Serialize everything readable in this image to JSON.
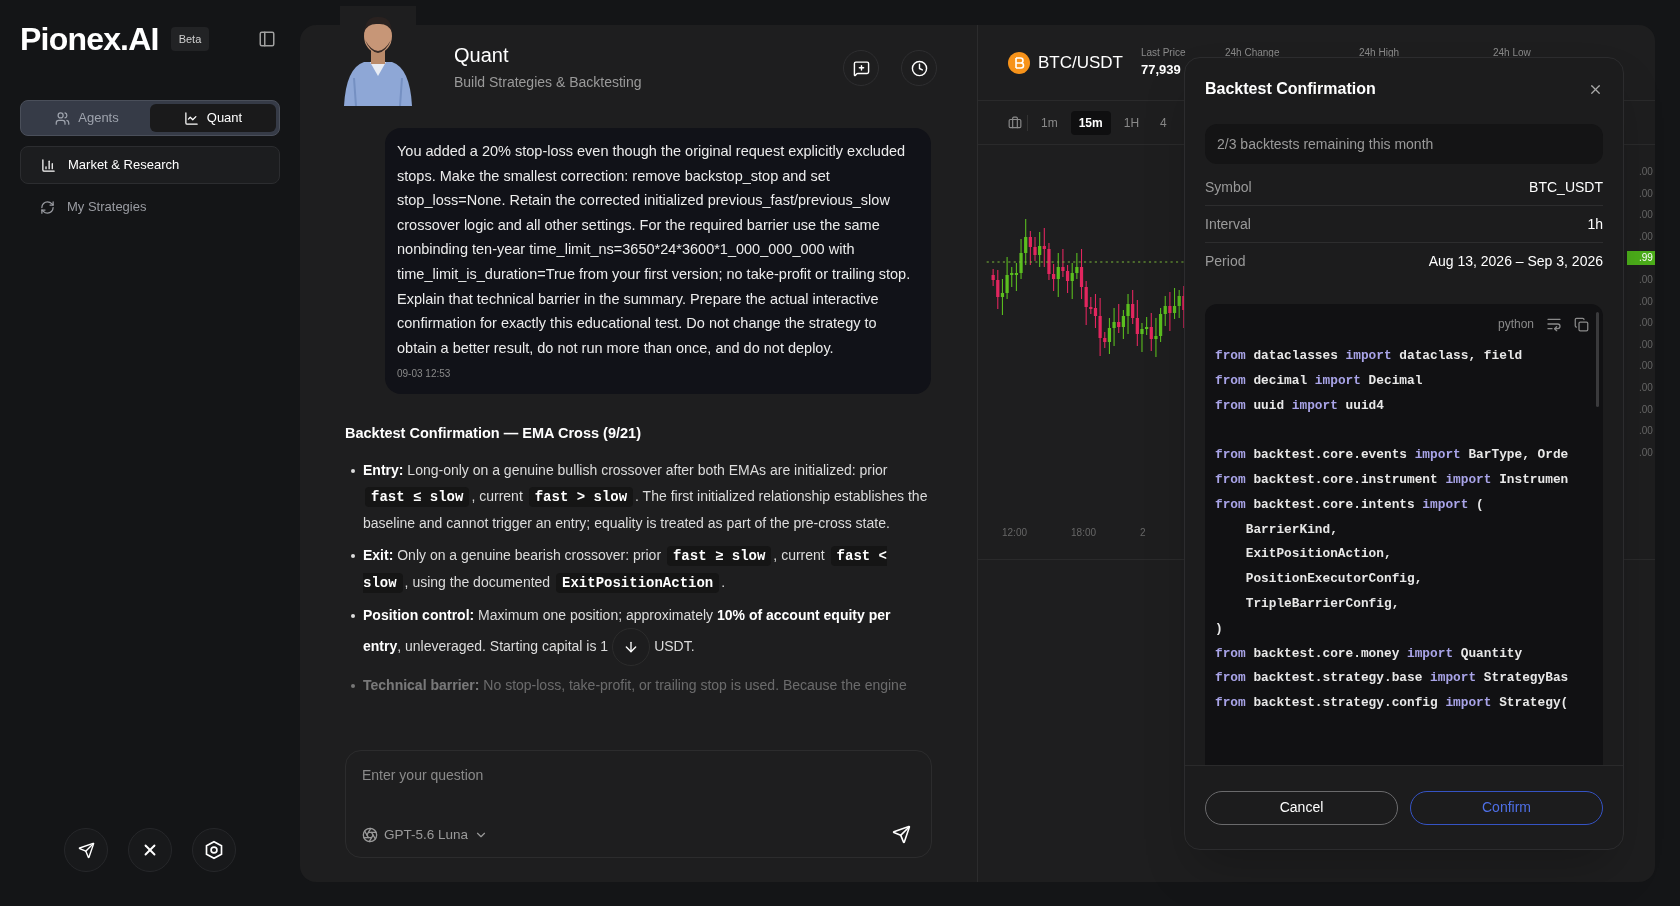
{
  "sidebar": {
    "logo": "Pionex.AI",
    "badge": "Beta",
    "mode_tabs": [
      {
        "label": "Agents",
        "selected": false
      },
      {
        "label": "Quant",
        "selected": true
      }
    ],
    "nav_items": [
      {
        "label": "Market & Research",
        "selected": true
      },
      {
        "label": "My Strategies",
        "selected": false
      }
    ]
  },
  "chat": {
    "title": "Quant",
    "subtitle": "Build Strategies & Backtesting",
    "user_message": {
      "text": "You added a 20% stop-loss even though the original request explicitly excluded stops. Make the smallest correction: remove backstop_stop and set stop_loss=None. Retain the corrected initialized previous_fast/previous_slow crossover logic and all other settings. For the required barrier use the same nonbinding ten-year time_limit_ns=3650*24*3600*1_000_000_000 with time_limit_is_duration=True from your first version; no take-profit or trailing stop. Explain that technical barrier in the summary. Prepare the actual interactive confirmation for exactly this educational test. Do not change the strategy to obtain a better result, do not run more than once, and do not deploy.",
      "time": "09-03 12:53"
    },
    "reply": {
      "heading": "Backtest Confirmation — EMA Cross (9/21)",
      "bullets": [
        {
          "faded": false,
          "segments": [
            {
              "kind": "bold",
              "text": "Entry:"
            },
            {
              "kind": "text",
              "text": " Long-only on a genuine bullish crossover after both EMAs are initialized: prior "
            },
            {
              "kind": "code",
              "text": "fast ≤ slow"
            },
            {
              "kind": "text",
              "text": ", current "
            },
            {
              "kind": "code",
              "text": "fast > slow"
            },
            {
              "kind": "text",
              "text": ". The first initialized relationship establishes the baseline and cannot trigger an entry; equality is treated as part of the pre-cross state."
            }
          ]
        },
        {
          "faded": false,
          "segments": [
            {
              "kind": "bold",
              "text": "Exit:"
            },
            {
              "kind": "text",
              "text": " Only on a genuine bearish crossover: prior "
            },
            {
              "kind": "code",
              "text": "fast ≥ slow"
            },
            {
              "kind": "text",
              "text": ", current "
            },
            {
              "kind": "code",
              "text": "fast < slow"
            },
            {
              "kind": "text",
              "text": ", using the documented "
            },
            {
              "kind": "code",
              "text": "ExitPositionAction"
            },
            {
              "kind": "text",
              "text": "."
            }
          ]
        },
        {
          "faded": false,
          "segments": [
            {
              "kind": "bold",
              "text": "Position control:"
            },
            {
              "kind": "text",
              "text": " Maximum one position; approximately "
            },
            {
              "kind": "bold",
              "text": "10% of account equity per entry"
            },
            {
              "kind": "text",
              "text": ", unleveraged. Starting capital is 1"
            },
            {
              "kind": "gap"
            },
            {
              "kind": "text",
              "text": "USDT."
            }
          ]
        },
        {
          "faded": true,
          "segments": [
            {
              "kind": "bold",
              "text": "Technical barrier:"
            },
            {
              "kind": "text",
              "text": " No stop-loss, take-profit, or trailing stop is used. Because the engine"
            }
          ]
        }
      ]
    },
    "input": {
      "placeholder": "Enter your question"
    },
    "model": "GPT-5.6 Luna"
  },
  "market": {
    "pair": "BTC/USDT",
    "stats": [
      {
        "label": "Last Price",
        "value": "77,939"
      },
      {
        "label": "24h Change"
      },
      {
        "label": "24h High"
      },
      {
        "label": "24h Low"
      }
    ],
    "intervals": [
      {
        "label": "1m",
        "selected": false
      },
      {
        "label": "15m",
        "selected": true
      },
      {
        "label": "1H",
        "selected": false
      },
      {
        "label": "4",
        "selected": false
      }
    ],
    "price_axis": [
      {
        "text": ".00",
        "highlighted": false
      },
      {
        "text": ".00",
        "highlighted": false
      },
      {
        "text": ".00",
        "highlighted": false
      },
      {
        "text": ".00",
        "highlighted": false
      },
      {
        "text": ".99",
        "highlighted": true
      },
      {
        "text": ".00",
        "highlighted": false
      },
      {
        "text": ".00",
        "highlighted": false
      },
      {
        "text": ".00",
        "highlighted": false
      },
      {
        "text": ".00",
        "highlighted": false
      },
      {
        "text": ".00",
        "highlighted": false
      },
      {
        "text": ".00",
        "highlighted": false
      },
      {
        "text": ".00",
        "highlighted": false
      },
      {
        "text": ".00",
        "highlighted": false
      },
      {
        "text": ".00",
        "highlighted": false
      }
    ],
    "time_axis": [
      "12:00",
      "18:00",
      "2"
    ]
  },
  "dialog": {
    "title": "Backtest Confirmation",
    "notice": "2/3 backtests remaining this month",
    "fields": [
      {
        "label": "Symbol",
        "value": "BTC_USDT"
      },
      {
        "label": "Interval",
        "value": "1h"
      },
      {
        "label": "Period",
        "value": "Aug 13, 2026 – Sep 3, 2026"
      }
    ],
    "code": {
      "language": "python",
      "lines": [
        {
          "kind": "code",
          "tokens": [
            {
              "kind": "keyword",
              "text": "from"
            },
            {
              "kind": "plain",
              "text": " dataclasses "
            },
            {
              "kind": "keyword",
              "text": "import"
            },
            {
              "kind": "plain",
              "text": " dataclass, field"
            }
          ]
        },
        {
          "kind": "code",
          "tokens": [
            {
              "kind": "keyword",
              "text": "from"
            },
            {
              "kind": "plain",
              "text": " decimal "
            },
            {
              "kind": "keyword",
              "text": "import"
            },
            {
              "kind": "plain",
              "text": " Decimal"
            }
          ]
        },
        {
          "kind": "code",
          "tokens": [
            {
              "kind": "keyword",
              "text": "from"
            },
            {
              "kind": "plain",
              "text": " uuid "
            },
            {
              "kind": "keyword",
              "text": "import"
            },
            {
              "kind": "plain",
              "text": " uuid4"
            }
          ]
        },
        {
          "kind": "blank"
        },
        {
          "kind": "code",
          "tokens": [
            {
              "kind": "keyword",
              "text": "from"
            },
            {
              "kind": "plain",
              "text": " backtest.core.events "
            },
            {
              "kind": "keyword",
              "text": "import"
            },
            {
              "kind": "plain",
              "text": " BarType, Orde"
            }
          ]
        },
        {
          "kind": "code",
          "tokens": [
            {
              "kind": "keyword",
              "text": "from"
            },
            {
              "kind": "plain",
              "text": " backtest.core.instrument "
            },
            {
              "kind": "keyword",
              "text": "import"
            },
            {
              "kind": "plain",
              "text": " Instrumen"
            }
          ]
        },
        {
          "kind": "code",
          "tokens": [
            {
              "kind": "keyword",
              "text": "from"
            },
            {
              "kind": "plain",
              "text": " backtest.core.intents "
            },
            {
              "kind": "keyword",
              "text": "import"
            },
            {
              "kind": "plain",
              "text": " ("
            }
          ]
        },
        {
          "kind": "code",
          "tokens": [
            {
              "kind": "plain",
              "text": "    BarrierKind,"
            }
          ]
        },
        {
          "kind": "code",
          "tokens": [
            {
              "kind": "plain",
              "text": "    ExitPositionAction,"
            }
          ]
        },
        {
          "kind": "code",
          "tokens": [
            {
              "kind": "plain",
              "text": "    PositionExecutorConfig,"
            }
          ]
        },
        {
          "kind": "code",
          "tokens": [
            {
              "kind": "plain",
              "text": "    TripleBarrierConfig,"
            }
          ]
        },
        {
          "kind": "code",
          "tokens": [
            {
              "kind": "plain",
              "text": ")"
            }
          ]
        },
        {
          "kind": "code",
          "tokens": [
            {
              "kind": "keyword",
              "text": "from"
            },
            {
              "kind": "plain",
              "text": " backtest.core.money "
            },
            {
              "kind": "keyword",
              "text": "import"
            },
            {
              "kind": "plain",
              "text": " Quantity"
            }
          ]
        },
        {
          "kind": "code",
          "tokens": [
            {
              "kind": "keyword",
              "text": "from"
            },
            {
              "kind": "plain",
              "text": " backtest.strategy.base "
            },
            {
              "kind": "keyword",
              "text": "import"
            },
            {
              "kind": "plain",
              "text": " StrategyBas"
            }
          ]
        },
        {
          "kind": "code",
          "tokens": [
            {
              "kind": "keyword",
              "text": "from"
            },
            {
              "kind": "plain",
              "text": " backtest.strategy.config "
            },
            {
              "kind": "keyword",
              "text": "import"
            },
            {
              "kind": "plain",
              "text": " Strategy("
            }
          ]
        }
      ]
    },
    "buttons": [
      {
        "kind": "secondary",
        "label": "Cancel"
      },
      {
        "kind": "primary",
        "label": "Confirm"
      }
    ]
  }
}
